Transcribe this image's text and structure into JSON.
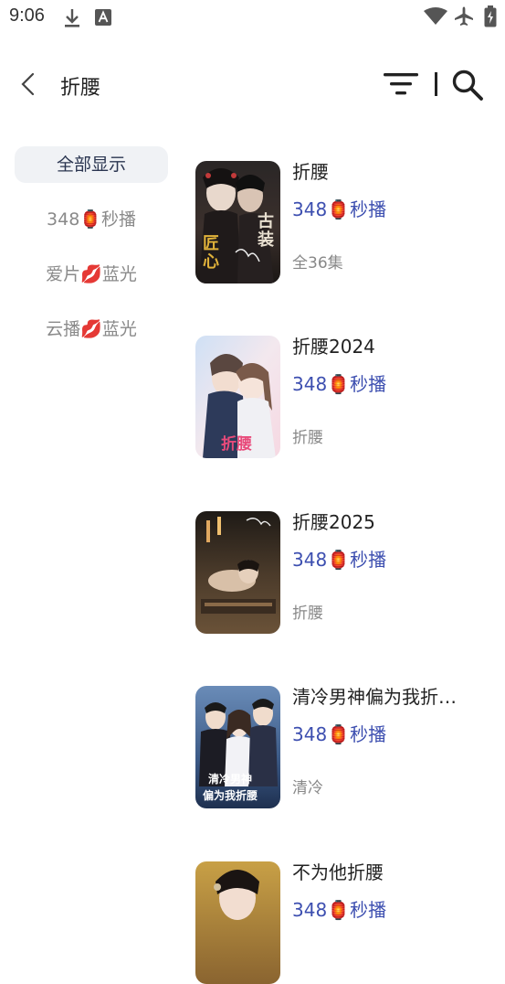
{
  "status_bar": {
    "time": "9:06",
    "icons": [
      "download-icon",
      "font-a-icon",
      "wifi-icon",
      "airplane-icon",
      "battery-icon"
    ]
  },
  "header": {
    "title": "折腰",
    "icons": [
      "back-chevron-icon",
      "filter-icon",
      "search-icon"
    ]
  },
  "sidebar": {
    "items": [
      {
        "label": "全部显示",
        "active": true
      },
      {
        "label": "348🏮秒播",
        "active": false
      },
      {
        "label": "爱片💋蓝光",
        "active": false
      },
      {
        "label": "云播💋蓝光",
        "active": false
      }
    ]
  },
  "results": [
    {
      "title": "折腰",
      "source": "348🏮秒播",
      "note": "全36集",
      "poster_text": "匠心 古装"
    },
    {
      "title": "折腰2024",
      "source": "348🏮秒播",
      "note": "折腰",
      "poster_text": "折腰"
    },
    {
      "title": "折腰2025",
      "source": "348🏮秒播",
      "note": "折腰",
      "poster_text": ""
    },
    {
      "title": "清冷男神偏为我折…",
      "source": "348🏮秒播",
      "note": "清冷",
      "poster_text": "清冷男神 偏为我折腰"
    },
    {
      "title": "不为他折腰",
      "source": "348🏮秒播",
      "note": "",
      "poster_text": ""
    }
  ],
  "colors": {
    "accent": "#3d4fb0",
    "active_bg": "#f0f2f5",
    "muted": "#8a8a8a"
  }
}
